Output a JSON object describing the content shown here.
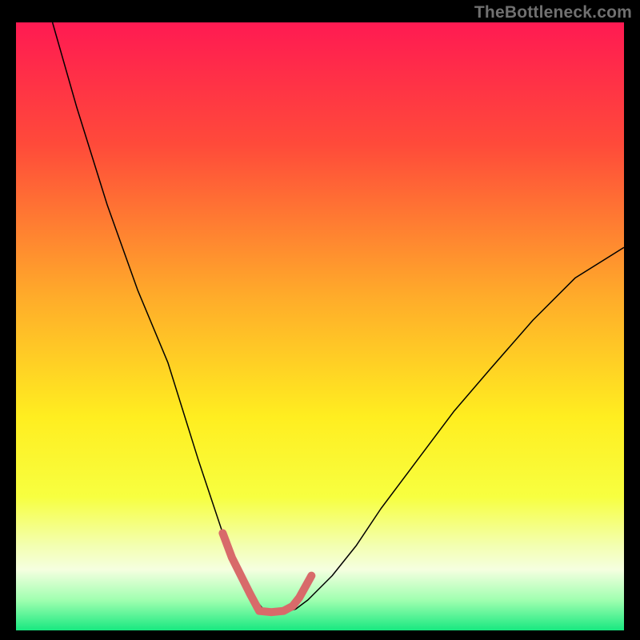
{
  "watermark": {
    "text": "TheBottleneck.com"
  },
  "chart_data": {
    "type": "line",
    "title": "",
    "xlabel": "",
    "ylabel": "",
    "xlim": [
      0,
      100
    ],
    "ylim": [
      0,
      100
    ],
    "background_gradient": {
      "dir": "vertical",
      "stops": [
        {
          "pos": 0.0,
          "color": "#ff1a52"
        },
        {
          "pos": 0.2,
          "color": "#ff4a3a"
        },
        {
          "pos": 0.45,
          "color": "#ffab2a"
        },
        {
          "pos": 0.65,
          "color": "#ffee20"
        },
        {
          "pos": 0.78,
          "color": "#f7ff40"
        },
        {
          "pos": 0.86,
          "color": "#f3ffb0"
        },
        {
          "pos": 0.9,
          "color": "#f5ffe0"
        },
        {
          "pos": 0.95,
          "color": "#a0ffb0"
        },
        {
          "pos": 1.0,
          "color": "#18e880"
        }
      ]
    },
    "series": [
      {
        "name": "bottleneck-curve",
        "color": "#000000",
        "width": 1.5,
        "x": [
          6,
          10,
          15,
          20,
          25,
          30,
          34,
          36,
          38,
          41,
          44,
          46,
          48,
          52,
          56,
          60,
          66,
          72,
          78,
          85,
          92,
          100
        ],
        "y": [
          100,
          86,
          70,
          56,
          44,
          28,
          16,
          11,
          7,
          3,
          3,
          3.5,
          5,
          9,
          14,
          20,
          28,
          36,
          43,
          51,
          58,
          63
        ]
      },
      {
        "name": "optimal-band",
        "color": "#d86a6a",
        "width": 10,
        "cap": "round",
        "x": [
          34,
          35.5,
          36.5,
          37.5,
          38.5,
          40,
          42,
          44,
          45.5,
          46.6,
          47.6,
          48.6
        ],
        "y": [
          16,
          12,
          10,
          8,
          6,
          3.2,
          3.0,
          3.2,
          4.0,
          5.4,
          7.2,
          9.0
        ]
      }
    ]
  }
}
